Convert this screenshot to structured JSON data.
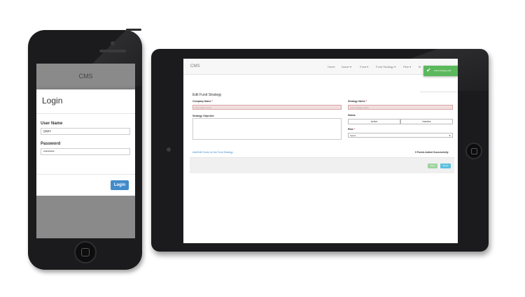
{
  "phone": {
    "header_title": "CMS",
    "login": {
      "title": "Login",
      "username_label": "User Name",
      "username_value": "gaps",
      "password_label": "Password",
      "password_value": "•••••••••",
      "login_button": "Login"
    }
  },
  "tablet": {
    "brand": "CMS",
    "nav": [
      "Home",
      "Issuer ▾",
      "Fund ▾",
      "Fund Strategy ▾",
      "Plan ▾",
      "M"
    ],
    "toast": {
      "message": "Fund strategy add"
    },
    "form": {
      "title": "Edit Fund Strategy",
      "company_label": "Company Name",
      "company_placeholder": "enter issuer name",
      "strategy_label": "Strategy Name",
      "strategy_placeholder": "enter strategy name",
      "objective_label": "Strategy Objective",
      "status_label": "Status",
      "status_options": [
        "Active",
        "Inactive"
      ],
      "risk_label": "Risk",
      "risk_value": "Select",
      "funds_link": "Add/Edit Funds for the Fund Strategy",
      "funds_added": "0 Funds Added Successfully",
      "save_button": "Save",
      "reset_button": "Reset"
    }
  },
  "colors": {
    "primary": "#428bca",
    "success": "#5cb85c",
    "info": "#5bc0de",
    "error_bg": "#f2dede"
  }
}
